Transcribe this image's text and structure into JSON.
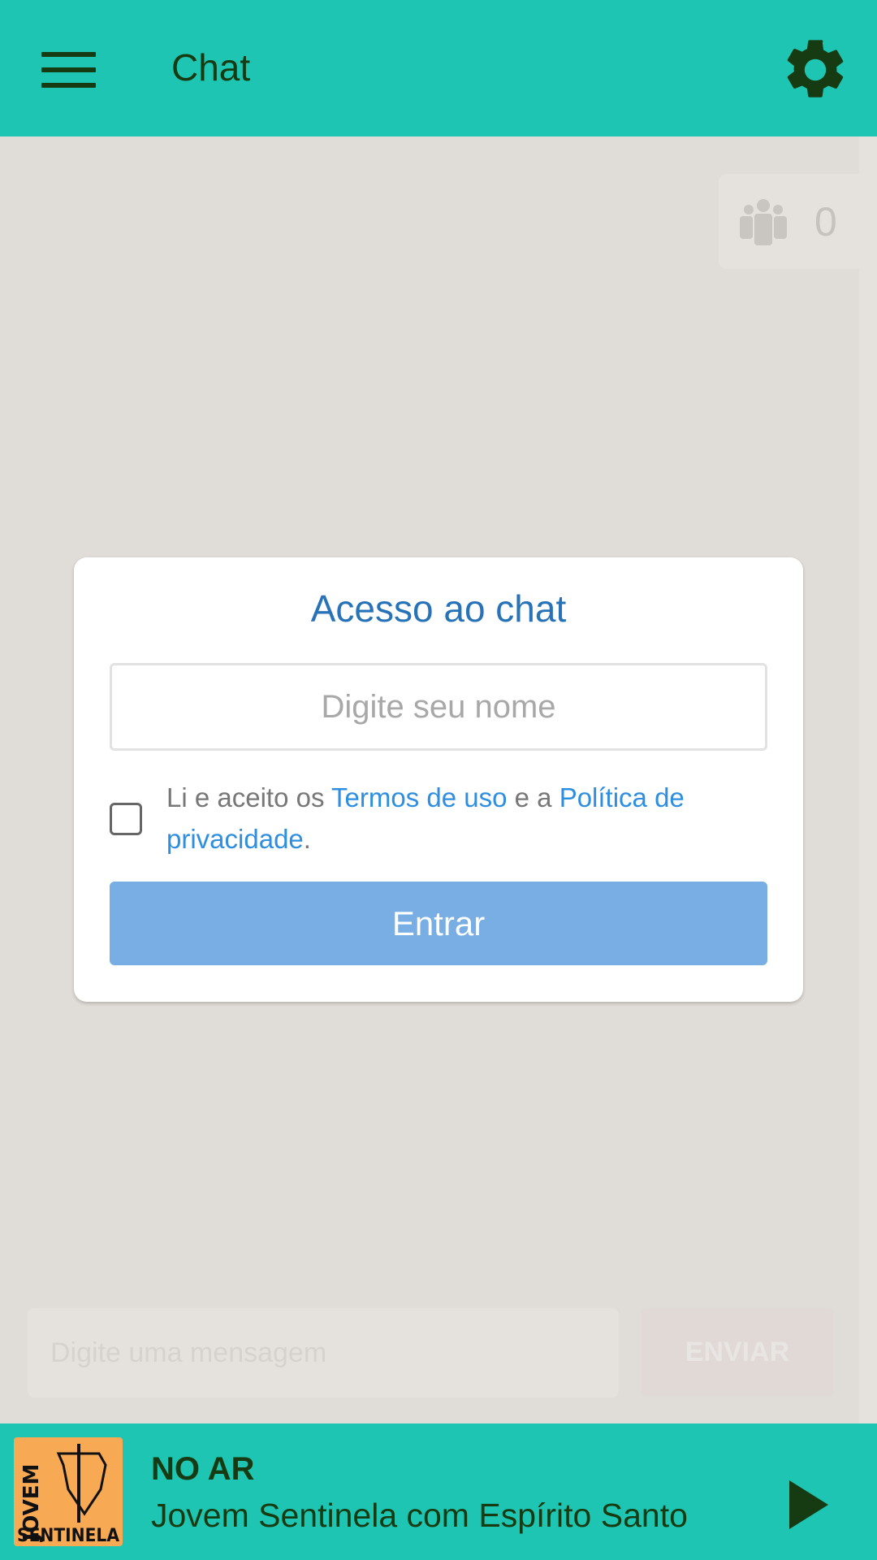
{
  "header": {
    "title": "Chat",
    "menu_icon": "hamburger-icon",
    "settings_icon": "gear-icon"
  },
  "online_users": {
    "icon": "users-icon",
    "count": "0"
  },
  "login_dialog": {
    "title": "Acesso ao chat",
    "name_placeholder": "Digite seu nome",
    "terms_prefix": "Li e aceito os ",
    "terms_link": "Termos de uso",
    "terms_middle": " e a ",
    "privacy_link": "Política de privacidade",
    "terms_suffix": ".",
    "checkbox_checked": false,
    "submit_label": "Entrar"
  },
  "composer": {
    "placeholder": "Digite uma mensagem",
    "send_label": "ENVIAR"
  },
  "player": {
    "status": "NO AR",
    "program": "Jovem Sentinela com Espírito Santo",
    "logo_text": "JOVEM SENTINELA",
    "play_icon": "play-icon"
  },
  "colors": {
    "brand": "#1ec5b2",
    "dark": "#163a12",
    "title_blue": "#2873b8",
    "link_blue": "#2e8ee0",
    "button_blue": "#78aee3"
  }
}
